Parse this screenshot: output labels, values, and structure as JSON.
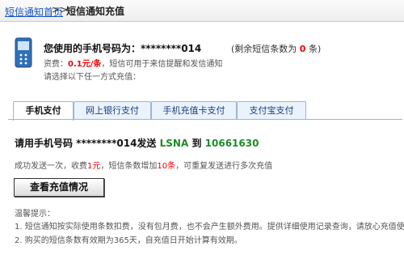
{
  "header": {
    "link": "短信通知首页",
    "separator": ">>",
    "current": "短信通知充值"
  },
  "account": {
    "title": "您使用的手机号码为：********014",
    "remaining_prefix": "(剩余短信条数为",
    "remaining_count": "0",
    "remaining_suffix": "条)",
    "fee_prefix": "资费：",
    "fee_price": "0.1元/条",
    "fee_suffix": "，短信可用于来信提醒和发信通知",
    "choose_text": "请选择以下任一方式充值："
  },
  "tabs": [
    {
      "label": "手机支付",
      "active": true
    },
    {
      "label": "网上银行支付",
      "active": false
    },
    {
      "label": "手机充值卡支付",
      "active": false
    },
    {
      "label": "支付宝支付",
      "active": false
    }
  ],
  "payment": {
    "instruction_prefix": "请用手机号码 ********014发送",
    "code": "LSNA",
    "to_text": "到",
    "number": "10661630",
    "success_prefix": "成功发送一次，收费",
    "success_fee": "1元",
    "success_mid": "，短信条数增加",
    "success_count": "10条",
    "success_suffix": "，可重复发送进行多次充值"
  },
  "button": {
    "label": "查看充值情况"
  },
  "tips": {
    "title": "温馨提示：",
    "items": [
      "1. 短信通知按实际使用条数扣费，没有包月费，也不会产生额外费用。提供详细使用记录查询，请放心充值使用。",
      "2. 购买的短信条数有效期为365天，自充值日开始计算有效期。"
    ]
  },
  "colors": {
    "link": "#1a56c4",
    "red": "#e00000",
    "green": "#1f8a2a",
    "tab_border": "#9bb6d6"
  },
  "icons": {
    "phone": "mobile-phone-icon"
  }
}
